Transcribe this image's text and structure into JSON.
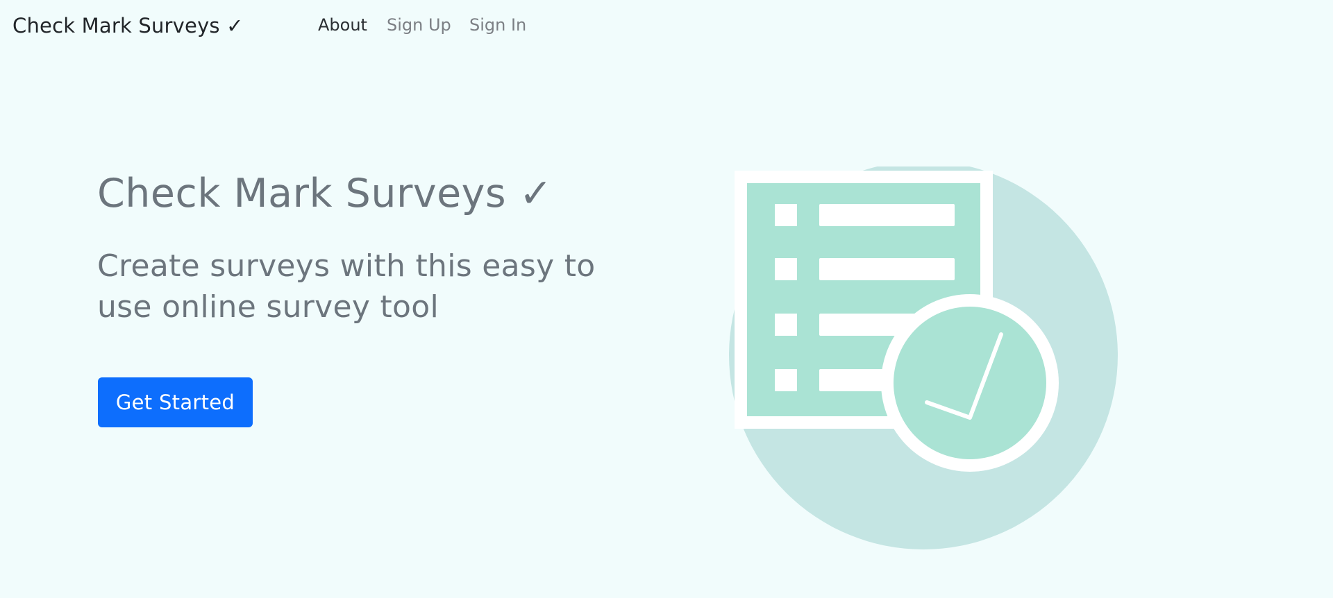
{
  "navbar": {
    "brand": "Check Mark Surveys ✓",
    "links": [
      {
        "label": "About"
      },
      {
        "label": "Sign Up"
      },
      {
        "label": "Sign In"
      }
    ]
  },
  "hero": {
    "title": "Check Mark Surveys ✓",
    "subtitle": "Create surveys with this easy to use online survey tool",
    "cta_label": "Get Started"
  },
  "colors": {
    "page_background": "#f1fcfc",
    "primary_button": "#0d6efd",
    "muted_text": "#6c757d",
    "illustration_mint": "#aae3d4",
    "illustration_circle": "#c4e5e3"
  },
  "illustration": {
    "icon": "survey-checklist-icon",
    "row_count": 4
  }
}
